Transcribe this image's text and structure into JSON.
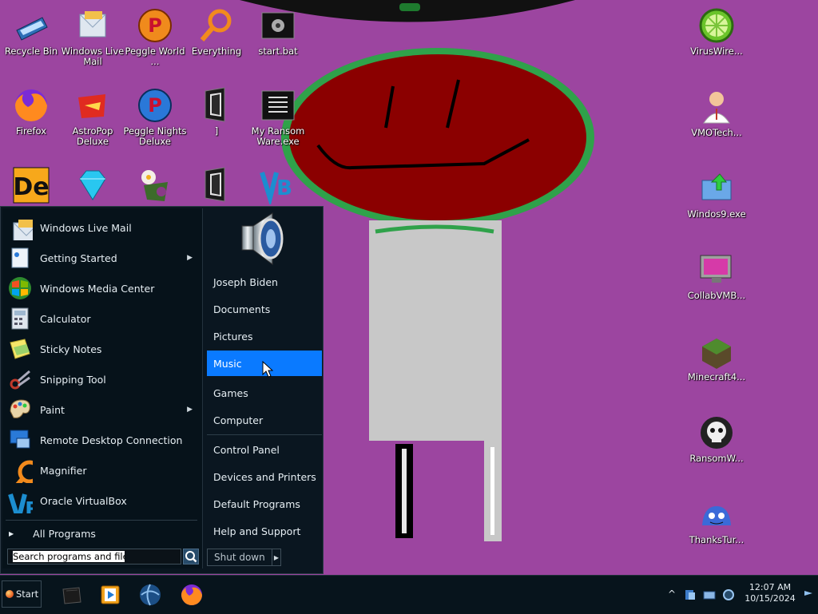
{
  "desktop": {
    "icons_left": [
      {
        "label": "Recycle Bin",
        "icon": "recycle-bin-icon"
      },
      {
        "label": "Windows Live Mail",
        "icon": "live-mail-icon"
      },
      {
        "label": "Peggle World ...",
        "icon": "peggle-icon"
      },
      {
        "label": "Everything",
        "icon": "magnifier-icon"
      },
      {
        "label": "start.bat",
        "icon": "batch-file-icon"
      },
      {
        "label": "Firefox",
        "icon": "firefox-icon"
      },
      {
        "label": "AstroPop Deluxe",
        "icon": "astropop-icon"
      },
      {
        "label": "Peggle Nights Deluxe",
        "icon": "peggle-nights-icon"
      },
      {
        "label": "]",
        "icon": "dark-folder-icon"
      },
      {
        "label": "My Ransom Ware.exe",
        "icon": "exe-file-icon"
      },
      {
        "label": "",
        "icon": "de-app-icon"
      },
      {
        "label": "",
        "icon": "diamond-icon"
      },
      {
        "label": "",
        "icon": "flower-game-icon"
      },
      {
        "label": "",
        "icon": "dark-folder-icon"
      },
      {
        "label": "",
        "icon": "virtualbox-icon"
      }
    ],
    "icons_right": [
      {
        "label": "VirusWire...",
        "icon": "lime-icon"
      },
      {
        "label": "VMOTech...",
        "icon": "doctor-icon"
      },
      {
        "label": "Windos9.exe",
        "icon": "installer-icon"
      },
      {
        "label": "CollabVMB...",
        "icon": "monitor-icon"
      },
      {
        "label": "Minecraft4...",
        "icon": "grass-block-icon"
      },
      {
        "label": "RansomW...",
        "icon": "skull-icon"
      },
      {
        "label": "ThanksTur...",
        "icon": "blue-creature-icon"
      }
    ]
  },
  "start_menu": {
    "programs": [
      {
        "label": "Windows Live Mail",
        "icon": "live-mail-icon",
        "submenu": false
      },
      {
        "label": "Getting Started",
        "icon": "getting-started-icon",
        "submenu": true
      },
      {
        "label": "Windows Media Center",
        "icon": "media-center-icon",
        "submenu": false
      },
      {
        "label": "Calculator",
        "icon": "calculator-icon",
        "submenu": false
      },
      {
        "label": "Sticky Notes",
        "icon": "sticky-notes-icon",
        "submenu": false
      },
      {
        "label": "Snipping Tool",
        "icon": "scissors-icon",
        "submenu": false
      },
      {
        "label": "Paint",
        "icon": "paint-palette-icon",
        "submenu": true
      },
      {
        "label": "Remote Desktop Connection",
        "icon": "remote-desktop-icon",
        "submenu": false
      },
      {
        "label": "Magnifier",
        "icon": "magnifier-icon",
        "submenu": false
      },
      {
        "label": "Oracle VirtualBox",
        "icon": "virtualbox-icon",
        "submenu": false
      }
    ],
    "all_programs": "All Programs",
    "search_placeholder": "Search programs and files",
    "user_picture_icon": "speaker-icon",
    "places": [
      {
        "label": "Joseph Biden",
        "active": false
      },
      {
        "label": "Documents",
        "active": false
      },
      {
        "label": "Pictures",
        "active": false
      },
      {
        "label": "Music",
        "active": true
      },
      {
        "label": "Games",
        "active": false
      },
      {
        "label": "Computer",
        "active": false
      },
      {
        "label": "Control Panel",
        "active": false
      },
      {
        "label": "Devices and Printers",
        "active": false
      },
      {
        "label": "Default Programs",
        "active": false
      },
      {
        "label": "Help and Support",
        "active": false
      }
    ],
    "shutdown_label": "Shut down"
  },
  "taskbar": {
    "start_label": "Start",
    "pinned": [
      "terminal-icon",
      "media-player-icon",
      "ie-globe-icon",
      "firefox-icon"
    ],
    "tray_icons": [
      "show-hidden-icons-chevron",
      "security-icon",
      "network-icon",
      "volume-icon",
      "action-center-flag-icon"
    ],
    "show_hidden": "^",
    "time": "12:07 AM",
    "date": "10/15/2024"
  },
  "colors": {
    "desktop_bg": "#9c45a0",
    "menu_bg": "#0a1620",
    "highlight": "#0a7aff",
    "wallpaper_face": "#8b0000",
    "wallpaper_ring": "#2fa24a"
  }
}
